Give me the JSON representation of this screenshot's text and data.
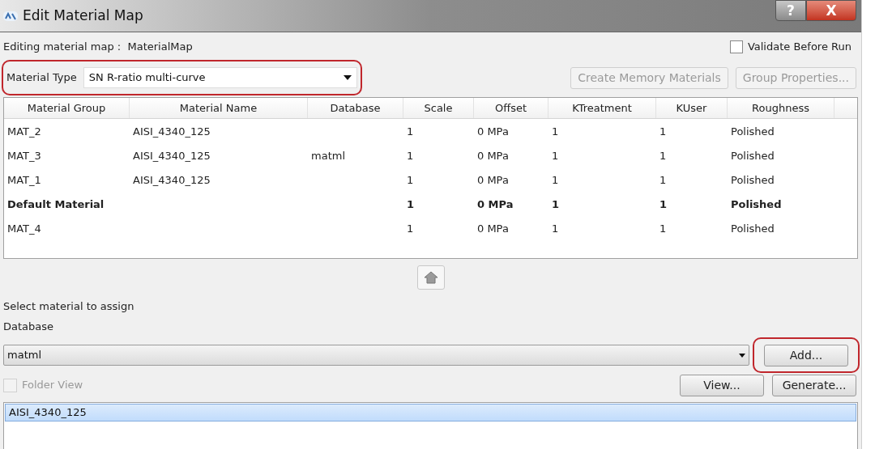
{
  "window": {
    "title": "Edit Material Map",
    "buttons": [
      {
        "kind": "help",
        "label": "?"
      },
      {
        "kind": "close",
        "label": "X"
      }
    ]
  },
  "editing": {
    "label": "Editing material map :",
    "value": "MaterialMap"
  },
  "validate": {
    "label": "Validate Before Run",
    "checked": false
  },
  "material_type": {
    "label": "Material Type",
    "value": "SN R-ratio multi-curve",
    "highlighted": true
  },
  "top_buttons": [
    {
      "label": "Create Memory Materials",
      "disabled": true
    },
    {
      "label": "Group Properties...",
      "disabled": true
    }
  ],
  "table": {
    "columns": [
      "Material Group",
      "Material Name",
      "Database",
      "Scale",
      "Offset",
      "KTreatment",
      "KUser",
      "Roughness"
    ],
    "rows": [
      {
        "cells": [
          "MAT_2",
          "AISI_4340_125",
          "",
          "1",
          "0 MPa",
          "1",
          "1",
          "Polished"
        ],
        "bold": false
      },
      {
        "cells": [
          "MAT_3",
          "AISI_4340_125",
          "matml",
          "1",
          "0 MPa",
          "1",
          "1",
          "Polished"
        ],
        "bold": false
      },
      {
        "cells": [
          "MAT_1",
          "AISI_4340_125",
          "",
          "1",
          "0 MPa",
          "1",
          "1",
          "Polished"
        ],
        "bold": false
      },
      {
        "cells": [
          "Default Material",
          "",
          "",
          "1",
          "0 MPa",
          "1",
          "1",
          "Polished"
        ],
        "bold": true
      },
      {
        "cells": [
          "MAT_4",
          "",
          "",
          "1",
          "0 MPa",
          "1",
          "1",
          "Polished"
        ],
        "bold": false
      }
    ]
  },
  "assign": {
    "title": "Select material to assign",
    "database_label": "Database",
    "database_value": "matml",
    "add_button": {
      "label": "Add...",
      "highlighted": true
    },
    "folder_view": {
      "label": "Folder View",
      "checked": false,
      "disabled": true
    },
    "buttons": [
      "View...",
      "Generate..."
    ],
    "materials": [
      {
        "label": "AISI_4340_125",
        "selected": true
      }
    ]
  }
}
